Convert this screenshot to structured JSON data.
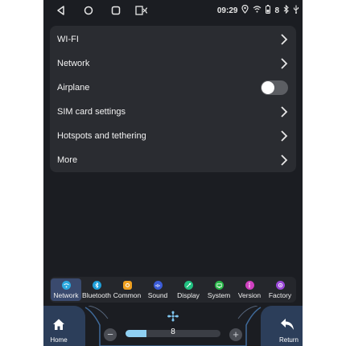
{
  "status": {
    "time": "09:29",
    "battery": "8",
    "nav_icons": [
      "back-icon",
      "home-icon",
      "recents-icon",
      "screen-mirror-icon"
    ],
    "status_icons": [
      "location-icon",
      "wifi-icon",
      "battery-icon",
      "bluetooth-icon",
      "usb-icon"
    ]
  },
  "settings": {
    "items": [
      {
        "label": "WI-FI",
        "control": "chevron"
      },
      {
        "label": "Network",
        "control": "chevron"
      },
      {
        "label": "Airplane",
        "control": "toggle",
        "value": false
      },
      {
        "label": "SIM card settings",
        "control": "chevron"
      },
      {
        "label": "Hotspots and tethering",
        "control": "chevron"
      },
      {
        "label": "More",
        "control": "chevron"
      }
    ]
  },
  "tabs": {
    "items": [
      {
        "label": "Network",
        "icon": "network-icon",
        "color": "#2aa9e0",
        "active": true
      },
      {
        "label": "Bluetooth",
        "icon": "bluetooth-icon",
        "color": "#1e9ed8",
        "active": false
      },
      {
        "label": "Common",
        "icon": "common-icon",
        "color": "#f0a020",
        "active": false
      },
      {
        "label": "Sound",
        "icon": "sound-icon",
        "color": "#3b5bd6",
        "active": false
      },
      {
        "label": "Display",
        "icon": "display-icon",
        "color": "#20c080",
        "active": false
      },
      {
        "label": "System",
        "icon": "system-icon",
        "color": "#28b848",
        "active": false
      },
      {
        "label": "Version",
        "icon": "version-icon",
        "color": "#d040c0",
        "active": false
      },
      {
        "label": "Factory",
        "icon": "factory-icon",
        "color": "#9a48d8",
        "active": false
      }
    ]
  },
  "dock": {
    "home_label": "Home",
    "return_label": "Return",
    "fan_value": "8",
    "fan_level_fraction": 0.22,
    "minus_symbol": "−",
    "plus_symbol": "+"
  },
  "colors": {
    "screen_bg": "#1b1d22",
    "card_bg": "#2a2c31",
    "accent": "#8fd0f3"
  }
}
